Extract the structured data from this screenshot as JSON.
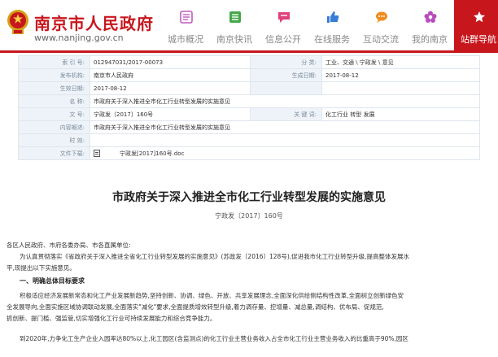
{
  "header": {
    "site_name": "南京市人民政府",
    "site_url": "www.nanjing.gov.cn",
    "nav": [
      {
        "label": "城市概况",
        "icon": "city-overview-icon",
        "active": false
      },
      {
        "label": "南京快讯",
        "icon": "news-icon",
        "active": false
      },
      {
        "label": "信息公开",
        "icon": "info-disclosure-icon",
        "active": false
      },
      {
        "label": "在线服务",
        "icon": "online-service-icon",
        "active": false
      },
      {
        "label": "互动交流",
        "icon": "interaction-icon",
        "active": false
      },
      {
        "label": "我的南京",
        "icon": "my-nanjing-icon",
        "active": false
      },
      {
        "label": "站群导航",
        "icon": "site-navigation-icon",
        "active": true
      }
    ],
    "colors": {
      "brand": "#c8161d"
    }
  },
  "meta": {
    "index_no_label": "索 引 号:",
    "index_no": "012947031/2017-00073",
    "category_label": "分 类:",
    "category": "工业、交通 \\ 宁政发 \\ 意见",
    "issuer_label": "发布机构:",
    "issuer": "南京市人民政府",
    "created_label": "生成日期:",
    "created": "2017-08-12",
    "publish_label": "生效日期:",
    "publish": "2017-08-12",
    "title_label": "名 称:",
    "title": "市政府关于深入推进全市化工行业转型发展的实施意见",
    "doc_no_label": "文 号:",
    "doc_no": "宁政发〔2017〕160号",
    "keywords_label": "关 键 词:",
    "keywords": "化工行业 转型 发展",
    "summary_label": "内容概述:",
    "summary": "市政府关于深入推进全市化工行业转型发展的实施意见",
    "timeliness_label": "时 效:",
    "attachment_label": "文件下载:",
    "attachment": "宁政发[2017]160号.doc"
  },
  "document": {
    "title": "市政府关于深入推进全市化工行业转型发展的实施意见",
    "number": "宁政发〔2017〕160号",
    "salutation": "各区人民政府、市府各委办局、市各直属单位:",
    "p1_line1": "为认真贯彻落实《省政府关于深入推进全省化工行业转型发展的实施意见》(苏政发〔2016〕128号),促进我市化工行业转型升级,提高整体发展水",
    "p1_line2": "平,现提出以下实施意见。",
    "section1": "一、明确总体目标要求",
    "p2_line1": "积极适应经济发展新常态和化工产业发展新趋势,坚持创新、协调、绿色、开放、共享发展理念,全面深化供给侧结构性改革,全面树立创新绿色安",
    "p2_line2": "全发展导向,全面实施区域协调联动发展,全面落实\"减化\"要求,全面提质增效转型升级,着力调存量、控增量、减总量,调结构、优布局、促规范,",
    "p2_line3": "抓创新、提门槛、强监管,切实增强化工行业可持续发展能力和综合竞争能力。",
    "p3_line1": "到2020年,力争化工生产企业入园率达80%以上,化工园区(含监测点)的化工行业主营业务收入占全市化工行业主营业务收入的比重高于90%,园区"
  }
}
